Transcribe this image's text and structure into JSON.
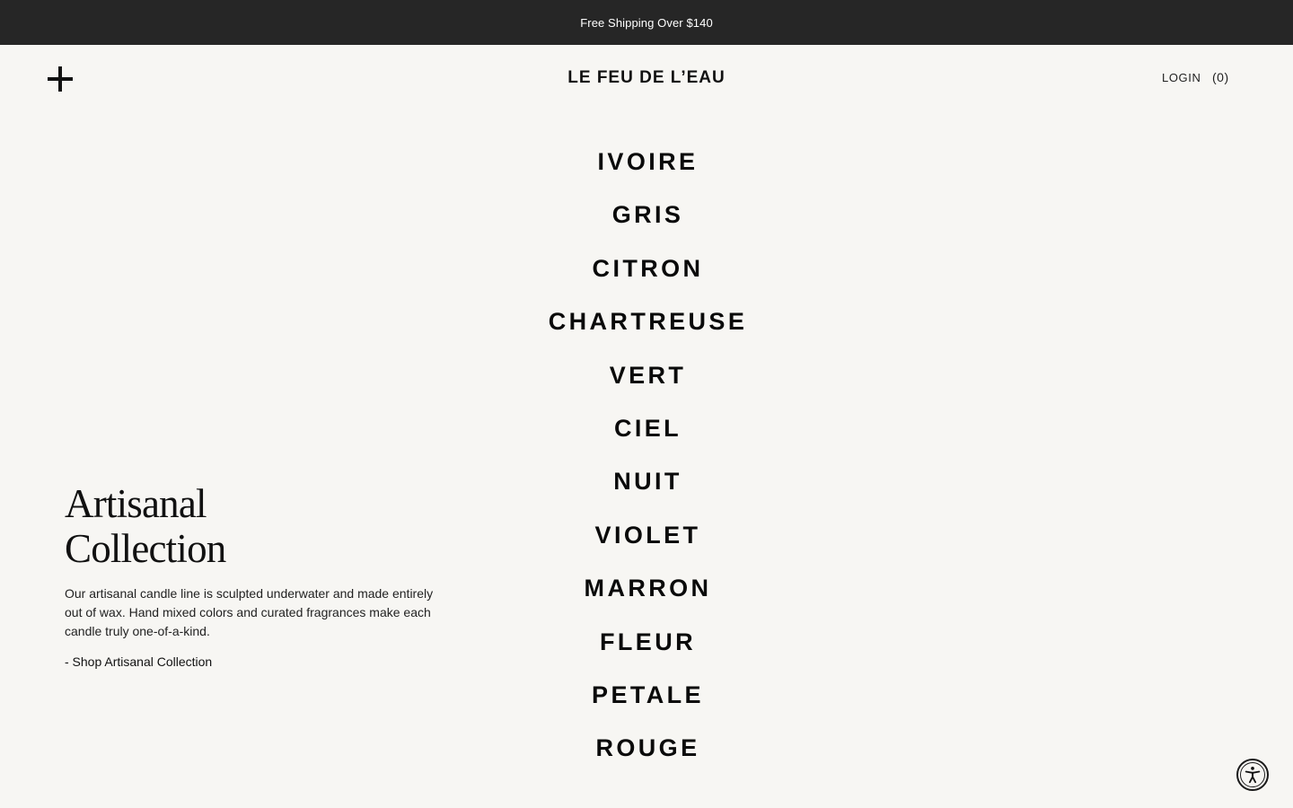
{
  "announcement": {
    "text": "Free Shipping Over $140"
  },
  "header": {
    "brand": "LE FEU DE L’EAU",
    "login_label": "LOGIN",
    "cart_label": "(0)",
    "menu_icon": "plus-icon"
  },
  "color_menu": {
    "items": [
      {
        "label": "IVOIRE"
      },
      {
        "label": "GRIS"
      },
      {
        "label": "CITRON"
      },
      {
        "label": "CHARTREUSE"
      },
      {
        "label": "VERT"
      },
      {
        "label": "CIEL"
      },
      {
        "label": "NUIT"
      },
      {
        "label": "VIOLET"
      },
      {
        "label": "MARRON"
      },
      {
        "label": "FLEUR"
      },
      {
        "label": "PETALE"
      },
      {
        "label": "ROUGE"
      }
    ]
  },
  "collection": {
    "title_line1": "Artisanal",
    "title_line2": "Collection",
    "description": "Our artisanal candle line is sculpted underwater and made entirely out of wax. Hand mixed colors and curated fragrances make each candle truly one-of-a-kind.",
    "link_label": "- Shop Artisanal Collection"
  },
  "accessibility": {
    "icon": "accessibility-icon"
  },
  "colors": {
    "background": "#f7f6f3",
    "announcement_bar": "#262626",
    "text": "#111111"
  }
}
